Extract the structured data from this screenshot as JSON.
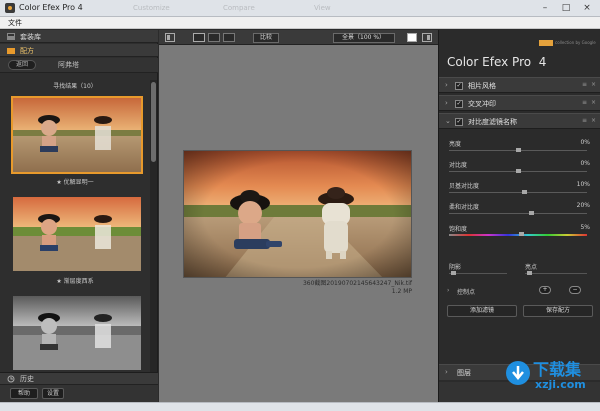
{
  "window": {
    "title": "Color Efex Pro 4",
    "ghost_tabs": [
      "Customize",
      "Compare",
      "View"
    ],
    "controls": {
      "minimize": "–",
      "maximize": "□",
      "close": "×"
    }
  },
  "menu": {
    "file": "文件"
  },
  "left_panel": {
    "presets_header": "套装库",
    "recipes_header": "配方",
    "back_button": "返回",
    "category": "阿弗塔",
    "section_title": "寻找结果（10）",
    "thumbnails": [
      {
        "caption": "★ 优解显明一",
        "selected": true,
        "style": "warm"
      },
      {
        "caption": "★ 渐层度西系",
        "selected": false,
        "style": "color"
      },
      {
        "caption": "",
        "selected": false,
        "style": "bw"
      }
    ],
    "history_label": "历史",
    "help_button": "帮助",
    "settings_button": "设置"
  },
  "center_panel": {
    "compare_button": "比较",
    "zoom_select": "全景（100 %）",
    "file_name": "360截图20190702145643247_Nik.tif",
    "file_size": "1.2 MP"
  },
  "right_panel": {
    "product_name": "Color Efex Pro",
    "product_version": "4",
    "brand_small": "collection by Google",
    "filters": [
      {
        "name": "相片风格",
        "expanded": false,
        "checked": true
      },
      {
        "name": "交叉冲印",
        "expanded": false,
        "checked": true
      },
      {
        "name": "对比度滤镜名称",
        "expanded": true,
        "checked": true
      }
    ],
    "sliders": [
      {
        "label": "亮度",
        "value": "0%",
        "level": 0.5
      },
      {
        "label": "对比度",
        "value": "0%",
        "level": 0.5
      },
      {
        "label": "贝基对比度",
        "value": "10%",
        "level": 0.55
      },
      {
        "label": "柔和对比度",
        "value": "20%",
        "level": 0.6
      },
      {
        "label": "饱和度",
        "value": "5%",
        "level": 0.53
      }
    ],
    "shadows_label": "阴影",
    "highlights_label": "亮点",
    "control_points_label": "控制点",
    "add_filter_button": "添加滤镜",
    "save_recipe_button": "保存配方",
    "footer_label": "图层"
  },
  "watermark": {
    "line1": "下载集",
    "line2": "xzji.com"
  },
  "colors": {
    "accent": "#e89a2c",
    "panel": "#2b2b2b",
    "canvas": "#7a7a7a"
  }
}
